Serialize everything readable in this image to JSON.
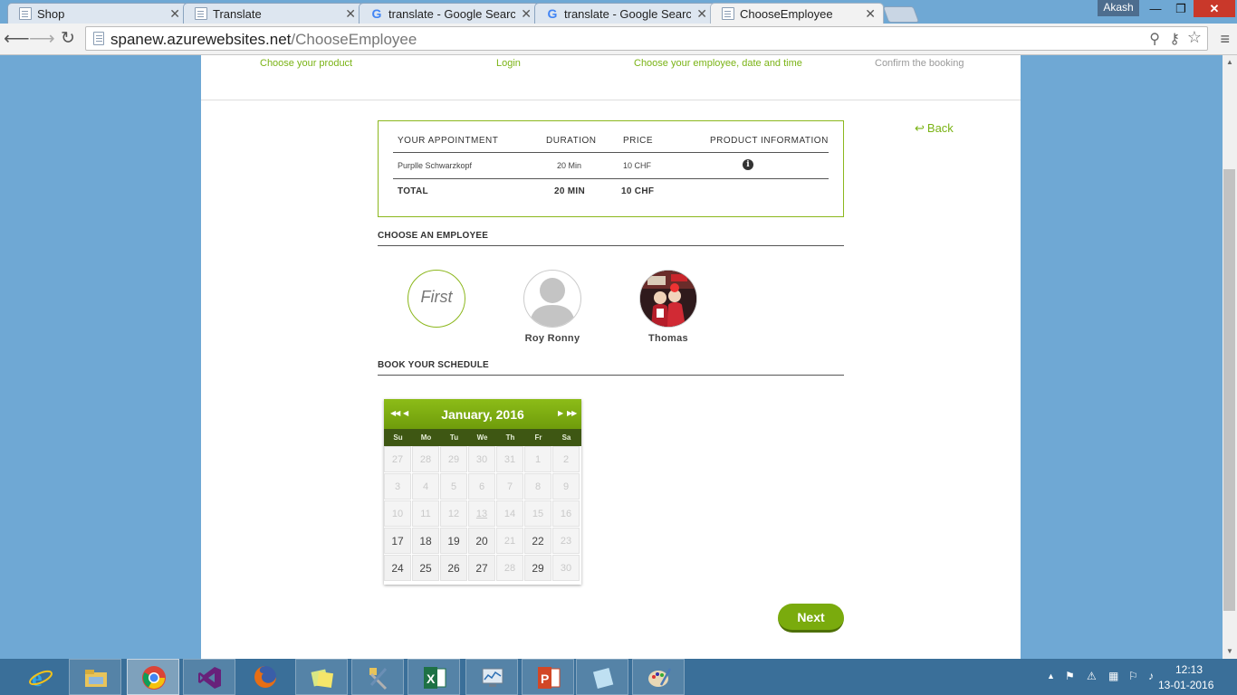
{
  "browser": {
    "tabs": [
      {
        "title": "Shop",
        "icon": "page-icon",
        "active": false
      },
      {
        "title": "Translate",
        "icon": "page-icon",
        "active": false
      },
      {
        "title": "translate - Google Search",
        "icon": "google-icon",
        "active": false
      },
      {
        "title": "translate - Google Search",
        "icon": "google-icon",
        "active": false
      },
      {
        "title": "ChooseEmployee",
        "icon": "page-icon",
        "active": true
      }
    ],
    "profile_name": "Akash",
    "url_host": "spanew.azurewebsites.net",
    "url_path": "/ChooseEmployee"
  },
  "steps": {
    "items": [
      {
        "label": "Choose your product",
        "state": "done"
      },
      {
        "label": "Login",
        "state": "done"
      },
      {
        "label": "Choose your employee, date and time",
        "state": "current"
      },
      {
        "label": "Confirm the booking",
        "state": "pending"
      }
    ]
  },
  "back_label": "Back",
  "appointment": {
    "headers": [
      "YOUR APPOINTMENT",
      "DURATION",
      "PRICE",
      "PRODUCT INFORMATION"
    ],
    "row": {
      "name": "Purplle Schwarzkopf",
      "duration": "20 Min",
      "price": "10 CHF"
    },
    "total": {
      "label": "TOTAL",
      "duration": "20 MIN",
      "price": "10 CHF"
    }
  },
  "employee_section_title": "CHOOSE AN EMPLOYEE",
  "employees": [
    {
      "name": "",
      "placeholder_text": "First",
      "selected": true
    },
    {
      "name": "Roy Ronny",
      "avatar": "default-user-avatar"
    },
    {
      "name": "Thomas",
      "avatar": "photo"
    }
  ],
  "schedule_section_title": "BOOK YOUR SCHEDULE",
  "calendar": {
    "title": "January, 2016",
    "weekdays": [
      "Su",
      "Mo",
      "Tu",
      "We",
      "Th",
      "Fr",
      "Sa"
    ],
    "today": "13",
    "weeks": [
      [
        {
          "d": "27",
          "a": false
        },
        {
          "d": "28",
          "a": false
        },
        {
          "d": "29",
          "a": false
        },
        {
          "d": "30",
          "a": false
        },
        {
          "d": "31",
          "a": false
        },
        {
          "d": "1",
          "a": false
        },
        {
          "d": "2",
          "a": false
        }
      ],
      [
        {
          "d": "3",
          "a": false
        },
        {
          "d": "4",
          "a": false
        },
        {
          "d": "5",
          "a": false
        },
        {
          "d": "6",
          "a": false
        },
        {
          "d": "7",
          "a": false
        },
        {
          "d": "8",
          "a": false
        },
        {
          "d": "9",
          "a": false
        }
      ],
      [
        {
          "d": "10",
          "a": false
        },
        {
          "d": "11",
          "a": false
        },
        {
          "d": "12",
          "a": false
        },
        {
          "d": "13",
          "a": false
        },
        {
          "d": "14",
          "a": false
        },
        {
          "d": "15",
          "a": false
        },
        {
          "d": "16",
          "a": false
        }
      ],
      [
        {
          "d": "17",
          "a": true
        },
        {
          "d": "18",
          "a": true
        },
        {
          "d": "19",
          "a": true
        },
        {
          "d": "20",
          "a": true
        },
        {
          "d": "21",
          "a": false
        },
        {
          "d": "22",
          "a": true
        },
        {
          "d": "23",
          "a": false
        }
      ],
      [
        {
          "d": "24",
          "a": true
        },
        {
          "d": "25",
          "a": true
        },
        {
          "d": "26",
          "a": true
        },
        {
          "d": "27",
          "a": true
        },
        {
          "d": "28",
          "a": false
        },
        {
          "d": "29",
          "a": true
        },
        {
          "d": "30",
          "a": false
        }
      ]
    ]
  },
  "next_label": "Next",
  "taskbar": {
    "apps": [
      {
        "name": "internet-explorer-icon",
        "state": "pinned"
      },
      {
        "name": "file-explorer-icon",
        "state": "running"
      },
      {
        "name": "chrome-icon",
        "state": "active"
      },
      {
        "name": "visual-studio-icon",
        "state": "running"
      },
      {
        "name": "firefox-icon",
        "state": "pinned"
      },
      {
        "name": "sticky-notes-icon",
        "state": "running"
      },
      {
        "name": "tools-icon",
        "state": "running"
      },
      {
        "name": "excel-icon",
        "state": "running"
      },
      {
        "name": "performance-monitor-icon",
        "state": "running"
      },
      {
        "name": "powerpoint-icon",
        "state": "running"
      },
      {
        "name": "notepad-icon",
        "state": "running"
      },
      {
        "name": "paint-icon",
        "state": "running"
      }
    ],
    "clock_time": "12:13",
    "clock_date": "13-01-2016"
  },
  "colors": {
    "accent": "#7ab315",
    "calendar_header": "#7aab0d",
    "calendar_dow": "#3e5713",
    "desktop": "#6fa8d4"
  }
}
